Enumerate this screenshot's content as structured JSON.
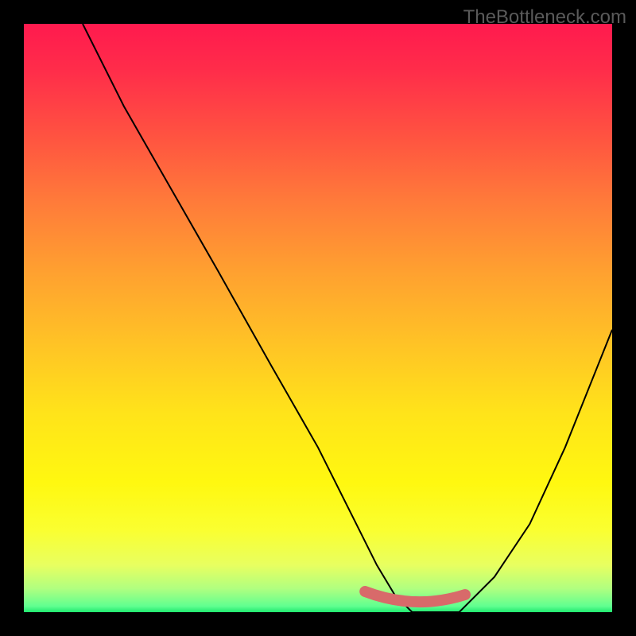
{
  "watermark": "TheBottleneck.com",
  "chart_data": {
    "type": "line",
    "title": "",
    "xlabel": "",
    "ylabel": "",
    "xlim": [
      0,
      100
    ],
    "ylim": [
      0,
      100
    ],
    "series": [
      {
        "name": "curve",
        "x": [
          10,
          17,
          25,
          33,
          42,
          50,
          56,
          60,
          63,
          66,
          70,
          74,
          80,
          86,
          92,
          100
        ],
        "y": [
          100,
          86,
          72,
          58,
          42,
          28,
          16,
          8,
          3,
          0,
          0,
          0,
          6,
          15,
          28,
          48
        ]
      }
    ],
    "highlight_segment": {
      "x_range": [
        58,
        75
      ],
      "y": 0,
      "color": "#d86a6a"
    },
    "gradient_stops": [
      {
        "pos": 0,
        "color": "#ff1a4e"
      },
      {
        "pos": 20,
        "color": "#ff5640"
      },
      {
        "pos": 42,
        "color": "#ffa030"
      },
      {
        "pos": 66,
        "color": "#ffe31a"
      },
      {
        "pos": 86,
        "color": "#faff30"
      },
      {
        "pos": 96,
        "color": "#b0ff80"
      },
      {
        "pos": 100,
        "color": "#20e870"
      }
    ]
  }
}
